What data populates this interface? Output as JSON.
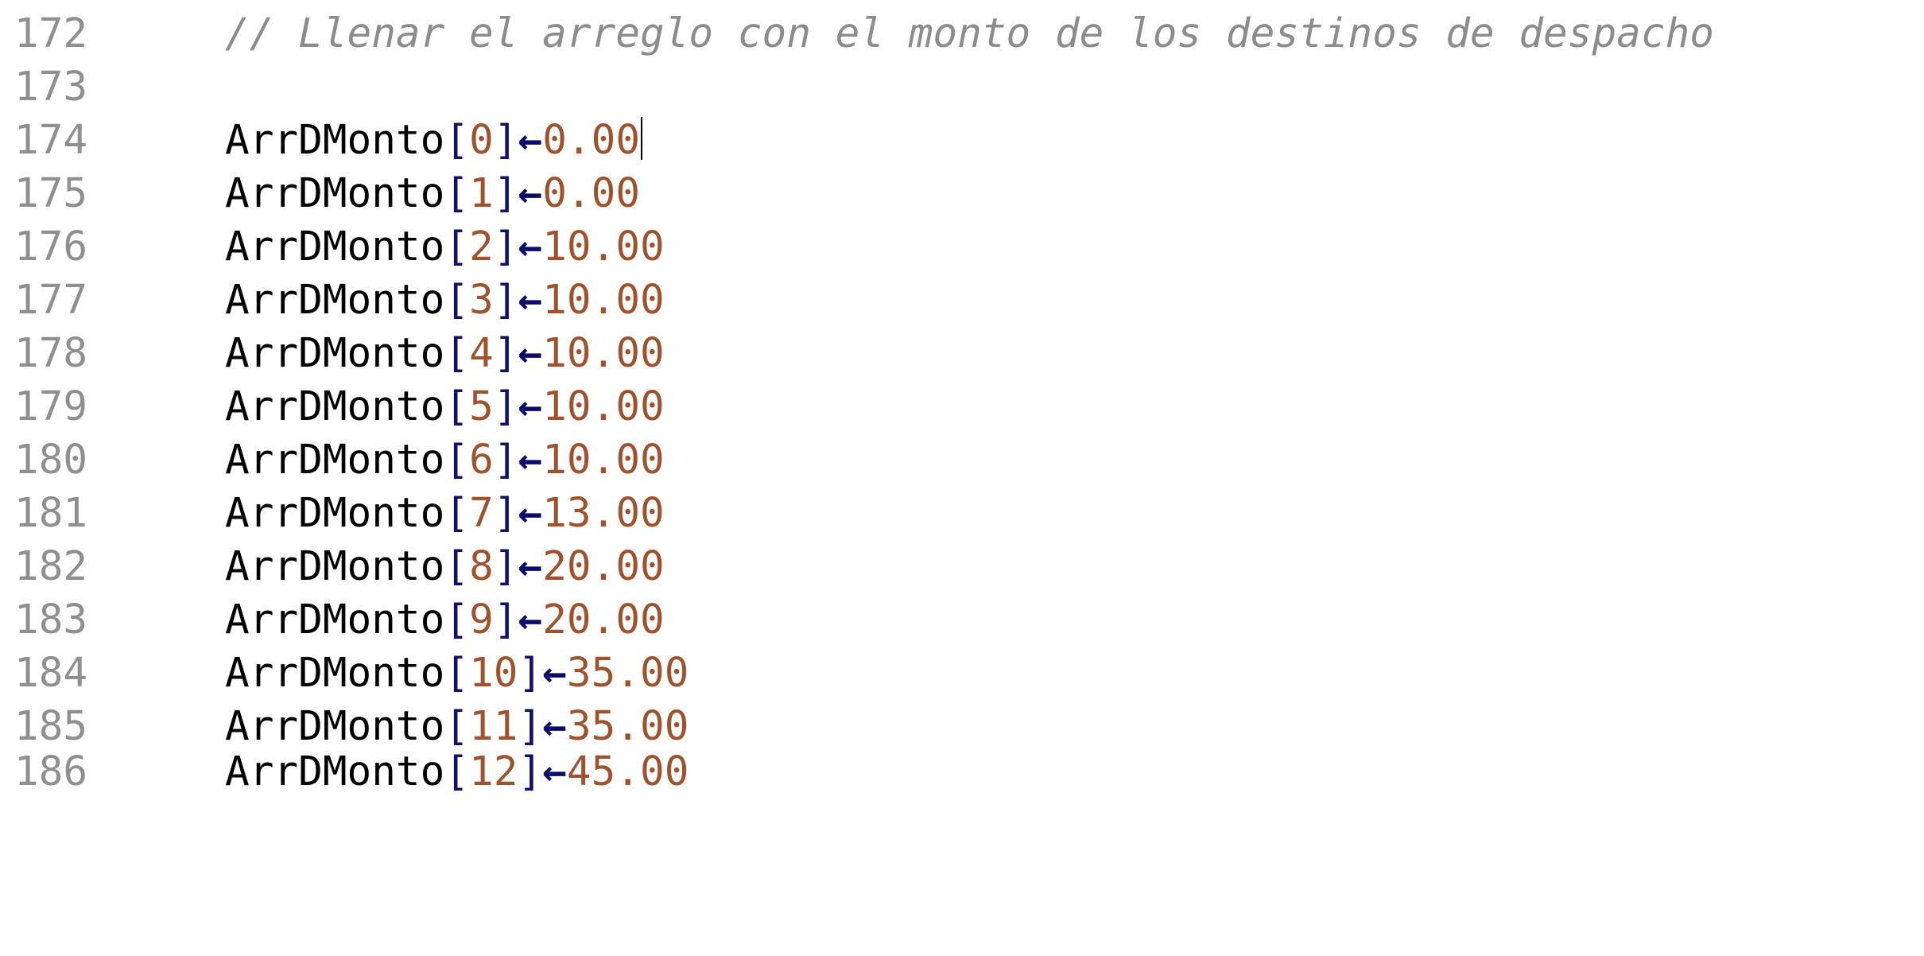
{
  "editor": {
    "comment_line": {
      "number": "172",
      "text": "// Llenar el arreglo con el monto de los destinos de despacho"
    },
    "blank_line": {
      "number": "173"
    },
    "assignments": [
      {
        "number": "174",
        "name": "ArrDMonto",
        "open": "[",
        "index": "0",
        "close": "]",
        "arrow": "←",
        "value": "0.00"
      },
      {
        "number": "175",
        "name": "ArrDMonto",
        "open": "[",
        "index": "1",
        "close": "]",
        "arrow": "←",
        "value": "0.00"
      },
      {
        "number": "176",
        "name": "ArrDMonto",
        "open": "[",
        "index": "2",
        "close": "]",
        "arrow": "←",
        "value": "10.00"
      },
      {
        "number": "177",
        "name": "ArrDMonto",
        "open": "[",
        "index": "3",
        "close": "]",
        "arrow": "←",
        "value": "10.00"
      },
      {
        "number": "178",
        "name": "ArrDMonto",
        "open": "[",
        "index": "4",
        "close": "]",
        "arrow": "←",
        "value": "10.00"
      },
      {
        "number": "179",
        "name": "ArrDMonto",
        "open": "[",
        "index": "5",
        "close": "]",
        "arrow": "←",
        "value": "10.00"
      },
      {
        "number": "180",
        "name": "ArrDMonto",
        "open": "[",
        "index": "6",
        "close": "]",
        "arrow": "←",
        "value": "10.00"
      },
      {
        "number": "181",
        "name": "ArrDMonto",
        "open": "[",
        "index": "7",
        "close": "]",
        "arrow": "←",
        "value": "13.00"
      },
      {
        "number": "182",
        "name": "ArrDMonto",
        "open": "[",
        "index": "8",
        "close": "]",
        "arrow": "←",
        "value": "20.00"
      },
      {
        "number": "183",
        "name": "ArrDMonto",
        "open": "[",
        "index": "9",
        "close": "]",
        "arrow": "←",
        "value": "20.00"
      },
      {
        "number": "184",
        "name": "ArrDMonto",
        "open": "[",
        "index": "10",
        "close": "]",
        "arrow": "←",
        "value": "35.00"
      },
      {
        "number": "185",
        "name": "ArrDMonto",
        "open": "[",
        "index": "11",
        "close": "]",
        "arrow": "←",
        "value": "35.00"
      },
      {
        "number": "186",
        "name": "ArrDMonto",
        "open": "[",
        "index": "12",
        "close": "]",
        "arrow": "←",
        "value": "45.00"
      }
    ],
    "colors": {
      "line_number": "#8f8f8f",
      "comment": "#8c8c8c",
      "identifier": "#000000",
      "bracket": "#10106e",
      "number": "#a0522d",
      "arrow": "#0a0a6e"
    }
  }
}
